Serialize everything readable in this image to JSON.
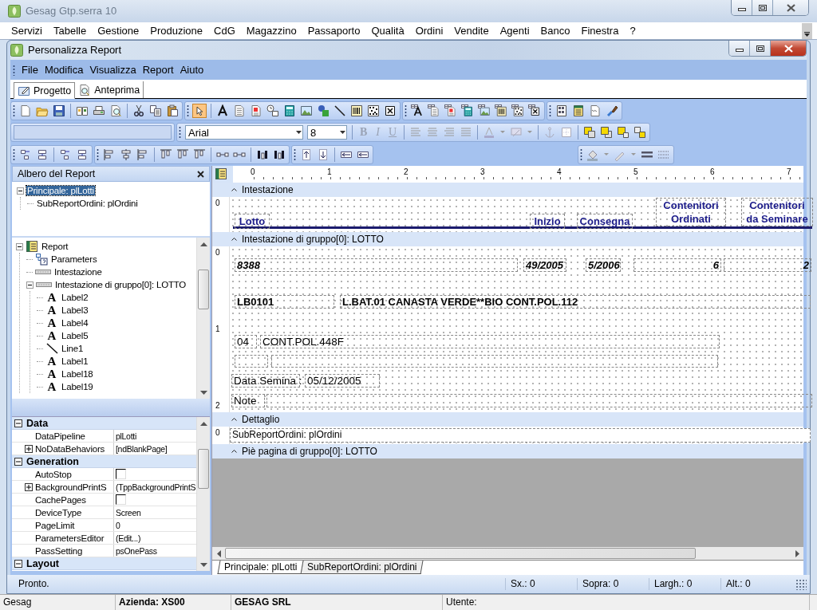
{
  "window": {
    "title": "Gesag Gtp.serra 10"
  },
  "menu_bar": [
    "Servizi",
    "Tabelle",
    "Gestione",
    "Produzione",
    "CdG",
    "Magazzino",
    "Passaporto",
    "Qualità",
    "Ordini",
    "Vendite",
    "Agenti",
    "Banco",
    "Finestra",
    "?"
  ],
  "child_window": {
    "title": "Personalizza Report"
  },
  "child_menu": [
    "File",
    "Modifica",
    "Visualizza",
    "Report",
    "Aiuto"
  ],
  "view_tabs": [
    {
      "label": "Progetto",
      "selected": true
    },
    {
      "label": "Anteprima",
      "selected": false
    }
  ],
  "toolbar": {
    "select_tool": {
      "selected": true
    },
    "font": "Arial",
    "size": "8",
    "format_buttons": [
      {
        "label": "B",
        "disabled": true
      },
      {
        "label": "I",
        "disabled": true
      },
      {
        "label": "U",
        "disabled": true
      }
    ]
  },
  "report_tree": {
    "title": "Albero del Report",
    "items": [
      {
        "label": "Principale: plLotti",
        "selected": true,
        "expanded": true,
        "children": [
          {
            "label": "SubReportOrdini: plOrdini",
            "selected": false
          }
        ]
      }
    ]
  },
  "component_tree": {
    "items": [
      {
        "label": "Report",
        "kind": "report",
        "selected": false,
        "expanded": true,
        "children": [
          {
            "label": "Parameters",
            "kind": "parameters",
            "selected": false
          },
          {
            "label": "Intestazione",
            "kind": "band",
            "selected": false
          },
          {
            "label": "Intestazione di gruppo[0]: LOTTO",
            "kind": "band",
            "selected": false,
            "expanded": true,
            "children": [
              {
                "label": "Label2",
                "kind": "label",
                "glyph": "A",
                "selected": false
              },
              {
                "label": "Label3",
                "kind": "label",
                "glyph": "A",
                "selected": false
              },
              {
                "label": "Label4",
                "kind": "label",
                "glyph": "A",
                "selected": false
              },
              {
                "label": "Label5",
                "kind": "label",
                "glyph": "A",
                "selected": false
              },
              {
                "label": "Line1",
                "kind": "line",
                "selected": false
              },
              {
                "label": "Label1",
                "kind": "label",
                "glyph": "A",
                "selected": false
              },
              {
                "label": "Label18",
                "kind": "label",
                "glyph": "A",
                "selected": false
              },
              {
                "label": "Label19",
                "kind": "label",
                "glyph": "A",
                "selected": false
              }
            ]
          }
        ]
      }
    ]
  },
  "properties": [
    {
      "title": "Data",
      "expanded": true,
      "rows": [
        {
          "name": "DataPipeline",
          "kind": "text",
          "value": "plLotti"
        },
        {
          "name": "NoDataBehaviors",
          "kind": "group",
          "expanded": false,
          "value": "[ndBlankPage]"
        }
      ]
    },
    {
      "title": "Generation",
      "expanded": true,
      "rows": [
        {
          "name": "AutoStop",
          "kind": "checkbox",
          "checked": false
        },
        {
          "name": "BackgroundPrintS",
          "kind": "group",
          "expanded": false,
          "value": "(TppBackgroundPrintS"
        },
        {
          "name": "CachePages",
          "kind": "checkbox",
          "checked": false
        },
        {
          "name": "DeviceType",
          "kind": "text",
          "value": "Screen"
        },
        {
          "name": "PageLimit",
          "kind": "text",
          "value": "0"
        },
        {
          "name": "ParametersEditor",
          "kind": "text",
          "value": "(Edit...)"
        },
        {
          "name": "PassSetting",
          "kind": "text",
          "value": "psOnePass"
        }
      ]
    },
    {
      "title": "Layout",
      "expanded": true
    }
  ],
  "designer": {
    "ruler_marks": [
      "0",
      "1",
      "2",
      "3",
      "4",
      "5",
      "6",
      "7"
    ],
    "bands": [
      {
        "title": "Intestazione",
        "ruler_marks": [
          "0"
        ],
        "labels": [
          {
            "text": "Lotto",
            "kind": "column-header"
          },
          {
            "text": "Inizio",
            "kind": "column-header"
          },
          {
            "text": "Consegna",
            "kind": "column-header"
          },
          {
            "text": "Contenitori Ordinati",
            "kind": "column-header"
          },
          {
            "text": "Contenitori da Seminare",
            "kind": "column-header"
          }
        ]
      },
      {
        "title": "Intestazione di gruppo[0]: LOTTO",
        "ruler_marks": [
          "0",
          "1",
          "2"
        ],
        "labels": [
          {
            "text": "8388",
            "kind": "bold-italic"
          },
          {
            "text": "49/2005",
            "kind": "bold-italic"
          },
          {
            "text": "5/2006",
            "kind": "bold-italic"
          },
          {
            "text": "6",
            "kind": "bold-italic-number"
          },
          {
            "text": "2",
            "kind": "bold-italic-number"
          },
          {
            "text": "LB0101",
            "kind": "bold"
          },
          {
            "text": "L.BAT.01 CANASTA VERDE**BIO CONT.POL.112",
            "kind": "bold"
          },
          {
            "text": "04",
            "kind": "plain"
          },
          {
            "text": "CONT.POL.448F",
            "kind": "plain"
          },
          {
            "text": "Data Semina :",
            "kind": "plain"
          },
          {
            "text": "05/12/2005",
            "kind": "plain"
          },
          {
            "text": "Note",
            "kind": "plain"
          }
        ]
      },
      {
        "title": "Dettaglio",
        "ruler_marks": [
          "0"
        ],
        "labels": [
          {
            "text": "SubReportOrdini: plOrdini",
            "kind": "subreport"
          }
        ]
      },
      {
        "title": "Piè pagina di gruppo[0]: LOTTO"
      }
    ],
    "sheet_tabs": [
      {
        "label": "Principale: plLotti",
        "selected": true
      },
      {
        "label": "SubReportOrdini: plOrdini",
        "selected": false
      }
    ]
  },
  "status_bar": [
    "Pronto.",
    "Sx.: 0",
    "Sopra: 0",
    "Largh.: 0",
    "Alt.: 0"
  ],
  "app_status_bar": [
    "Gesag",
    "Azienda: XS00",
    "GESAG SRL",
    "Utente:"
  ]
}
